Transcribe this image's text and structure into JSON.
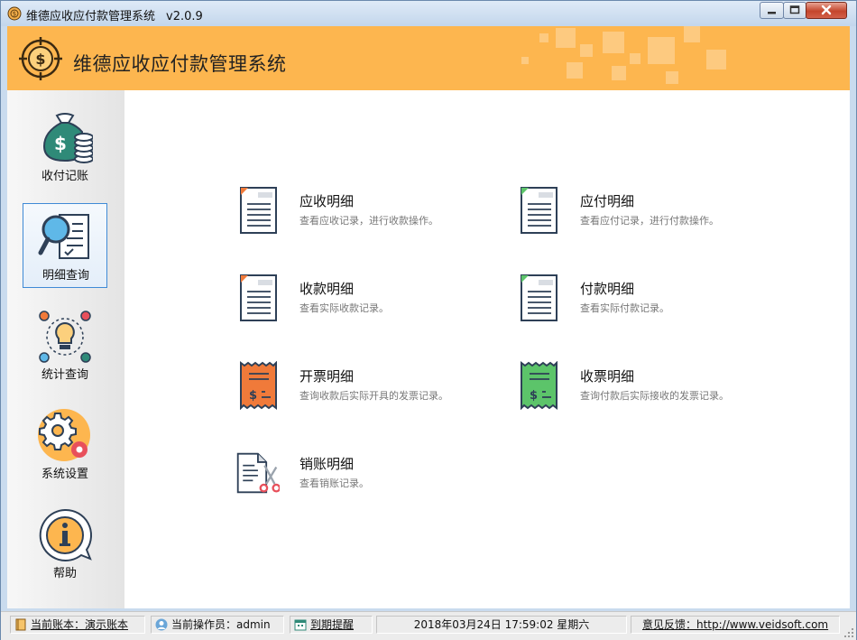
{
  "window": {
    "title": "维德应收应付款管理系统",
    "version": "v2.0.9"
  },
  "header": {
    "title": "维德应收应付款管理系统"
  },
  "sidebar": {
    "items": [
      {
        "label": "收付记账",
        "icon": "money-bag-icon"
      },
      {
        "label": "明细查询",
        "icon": "magnifier-document-icon",
        "selected": true
      },
      {
        "label": "统计查询",
        "icon": "lightbulb-cycle-icon"
      },
      {
        "label": "系统设置",
        "icon": "gears-icon"
      },
      {
        "label": "帮助",
        "icon": "info-bubble-icon"
      }
    ]
  },
  "main": {
    "tiles": [
      {
        "title": "应收明细",
        "desc": "查看应收记录，进行收款操作。",
        "icon": "document-orange-icon"
      },
      {
        "title": "应付明细",
        "desc": "查看应付记录，进行付款操作。",
        "icon": "document-green-icon"
      },
      {
        "title": "收款明细",
        "desc": "查看实际收款记录。",
        "icon": "document-orange-icon"
      },
      {
        "title": "付款明细",
        "desc": "查看实际付款记录。",
        "icon": "document-green-icon"
      },
      {
        "title": "开票明细",
        "desc": "查询收款后实际开具的发票记录。",
        "icon": "invoice-orange-icon"
      },
      {
        "title": "收票明细",
        "desc": "查询付款后实际接收的发票记录。",
        "icon": "invoice-green-icon"
      },
      {
        "title": "销账明细",
        "desc": "查看销账记录。",
        "icon": "document-scissors-icon"
      }
    ]
  },
  "statusbar": {
    "account": "当前账本：演示账本",
    "operator": "当前操作员：admin",
    "reminder": "到期提醒",
    "datetime": "2018年03月24日 17:59:02 星期六",
    "feedback": "意见反馈：http://www.veidsoft.com"
  },
  "colors": {
    "header_bg": "#fdb64f",
    "selected_border": "#3f8ad6",
    "accent_orange": "#f07a3a",
    "accent_green": "#5cc46a",
    "icon_navy": "#2e4057",
    "icon_teal": "#2f8a78"
  }
}
